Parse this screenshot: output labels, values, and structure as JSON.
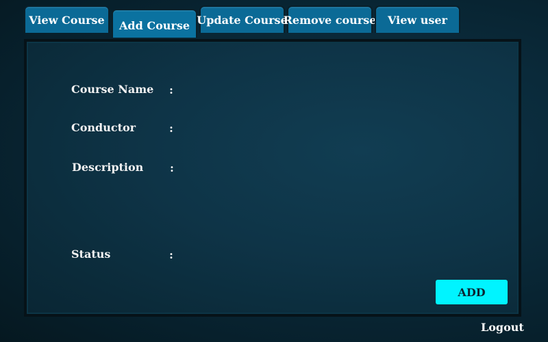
{
  "tabs": [
    {
      "label": "View Course"
    },
    {
      "label": "Add Course"
    },
    {
      "label": "Update Course"
    },
    {
      "label": "Remove course"
    },
    {
      "label": "View user"
    }
  ],
  "active_tab": "Add Course",
  "form": {
    "course_name_label": "Course Name",
    "conductor_label": "Conductor",
    "description_label": "Description",
    "status_label": "Status",
    "separator": ":"
  },
  "add_button_label": "ADD",
  "logout_label": "Logout",
  "colors": {
    "tab_background": "#0b6a96",
    "button_accent": "#00f4ff",
    "background": "#0a2a3a"
  }
}
